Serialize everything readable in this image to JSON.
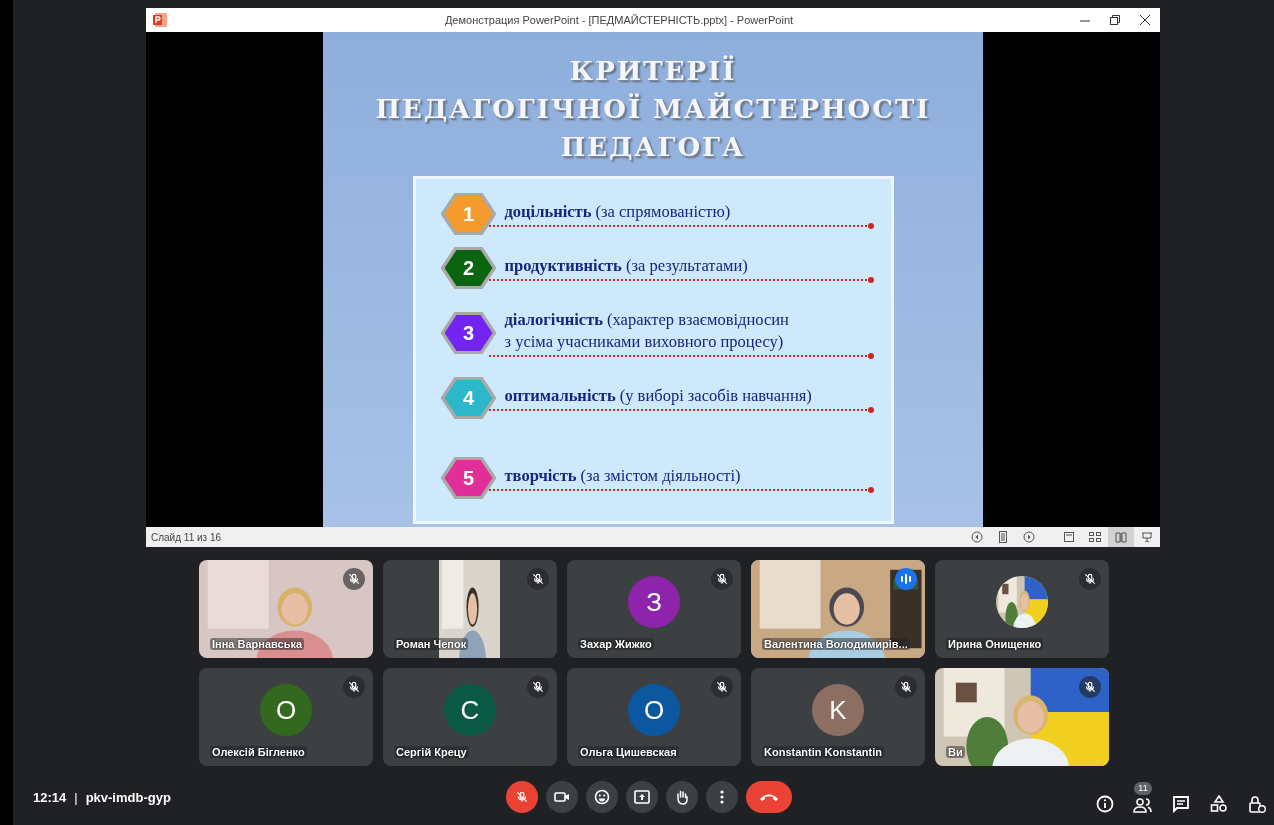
{
  "window": {
    "title": "Демонстрация PowerPoint - [ПЕДМАЙСТЕРНІСТЬ.pptx] - PowerPoint",
    "status": "Слайд 11 из 16",
    "slide": {
      "title_lines": [
        "КРИТЕРІЇ",
        "ПЕДАГОГІЧНОЇ МАЙСТЕРНОСТІ",
        "ПЕДАГОГА"
      ],
      "items": [
        {
          "number": "1",
          "color": "#f59b2e",
          "lines": [
            "**доцільність** (за спрямованістю)"
          ]
        },
        {
          "number": "2",
          "color": "#0d6410",
          "lines": [
            "**продуктивність** (за результатами)"
          ]
        },
        {
          "number": "3",
          "color": "#7424f2",
          "lines": [
            "**діалогічність** (характер взаємовідносин",
            "з усіма учасниками виховного процесу)"
          ]
        },
        {
          "number": "4",
          "color": "#2cb8c9",
          "lines": [
            "**оптимальність** (у виборі засобів навчання)"
          ]
        },
        {
          "number": "5",
          "color": "#e02f98",
          "lines": [
            "**творчість** (за змістом діяльності)"
          ]
        }
      ]
    }
  },
  "participants": [
    {
      "name": "Інна Варнавська",
      "kind": "video",
      "muted": true,
      "speaking": false
    },
    {
      "name": "Роман Чепок",
      "kind": "narrow_video",
      "muted": true,
      "speaking": false
    },
    {
      "name": "Захар Жижко",
      "kind": "initial",
      "initial": "З",
      "color": "#8e24aa",
      "muted": true,
      "speaking": false
    },
    {
      "name": "Валентина Володимирів...",
      "kind": "video",
      "muted": false,
      "speaking": true
    },
    {
      "name": "Ирина Онищенко",
      "muted": true,
      "speaking": false
    },
    {
      "name": "Олексій Бігленко",
      "kind": "initial",
      "initial": "О",
      "color": "#33691e",
      "muted": true,
      "speaking": false
    },
    {
      "name": "Сергій Крецу",
      "kind": "initial",
      "initial": "С",
      "color": "#0b5a45",
      "muted": true,
      "speaking": false
    },
    {
      "name": "Ольга Цишевская",
      "kind": "initial",
      "initial": "О",
      "color": "#0b57a0",
      "muted": true,
      "speaking": false
    },
    {
      "name": "Konstantin Konstantin",
      "kind": "initial",
      "initial": "K",
      "color": "#8d6e63",
      "muted": true,
      "speaking": false
    },
    {
      "name": "Ви",
      "kind": "video",
      "muted": true,
      "speaking": false
    }
  ],
  "meeting": {
    "time": "12:14",
    "separator": "|",
    "code": "pkv-imdb-gyp",
    "mic_muted": true,
    "people_count": "11"
  }
}
